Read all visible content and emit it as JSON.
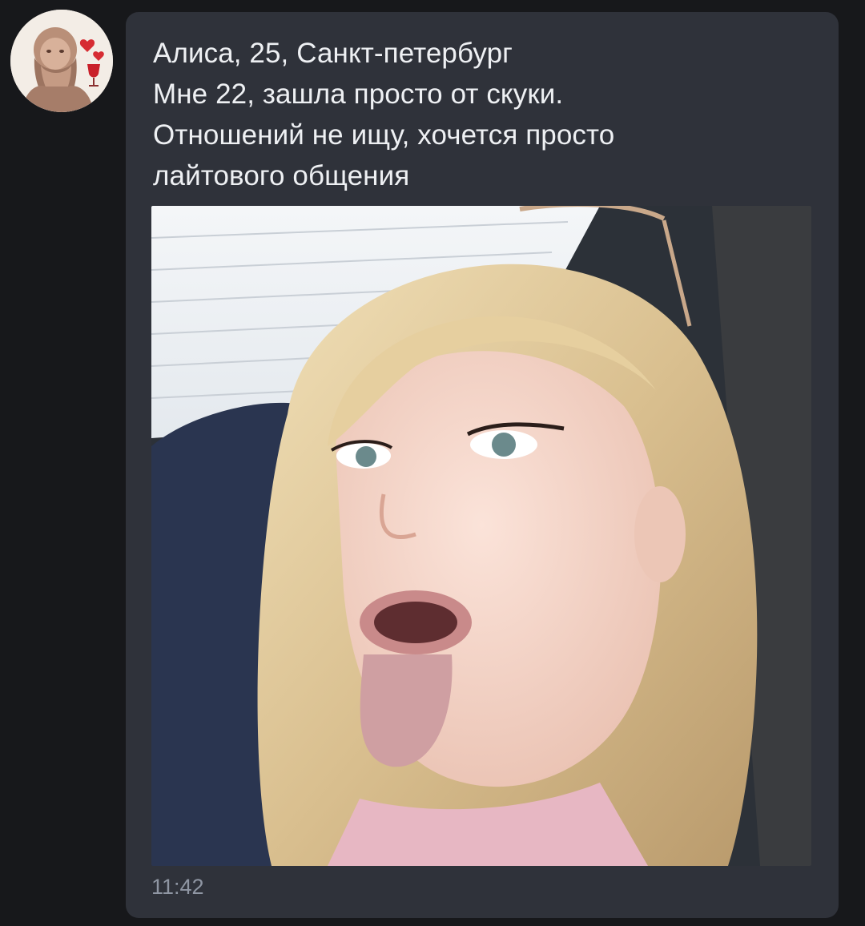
{
  "sender": {
    "avatar_icon": "bearded-man-portrait-with-hearts-and-wineglass"
  },
  "message": {
    "lines": [
      "Алиса, 25, Санкт-петербург",
      "Мне 22, зашла просто от скуки.",
      "Отношений не ищу, хочется просто",
      "лайтового общения"
    ],
    "photo_description": "selfie of a blonde girl in a car with sunglasses on her head",
    "time": "11:42"
  },
  "colors": {
    "background": "#17181b",
    "bubble": "#2f323a",
    "text": "#eef0f3",
    "timestamp": "#8f96a3"
  }
}
